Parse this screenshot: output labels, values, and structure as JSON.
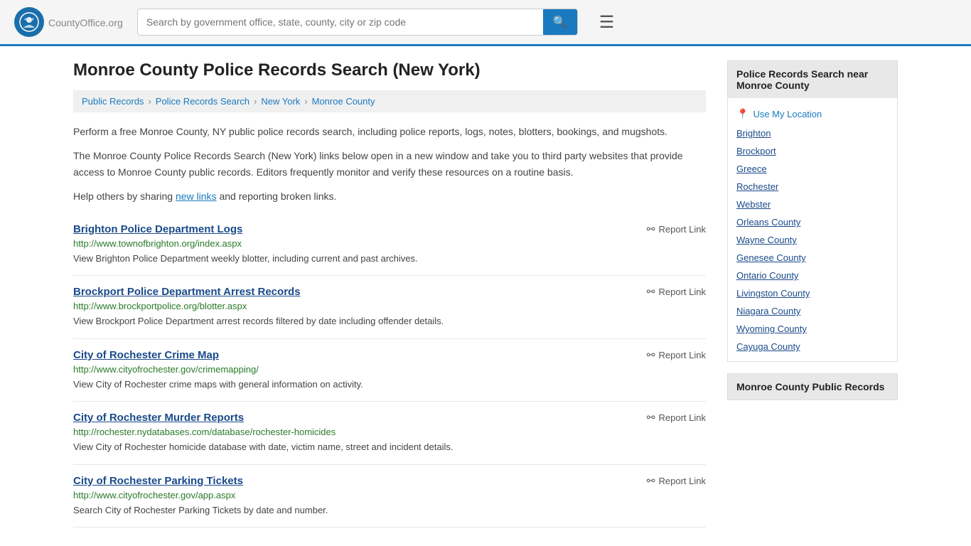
{
  "header": {
    "logo_text": "CountyOffice",
    "logo_suffix": ".org",
    "search_placeholder": "Search by government office, state, county, city or zip code"
  },
  "page": {
    "title": "Monroe County Police Records Search (New York)",
    "breadcrumb": [
      {
        "label": "Public Records",
        "href": "#"
      },
      {
        "label": "Police Records Search",
        "href": "#"
      },
      {
        "label": "New York",
        "href": "#"
      },
      {
        "label": "Monroe County",
        "href": "#"
      }
    ],
    "description1": "Perform a free Monroe County, NY public police records search, including police reports, logs, notes, blotters, bookings, and mugshots.",
    "description2": "The Monroe County Police Records Search (New York) links below open in a new window and take you to third party websites that provide access to Monroe County public records. Editors frequently monitor and verify these resources on a routine basis.",
    "description3_pre": "Help others by sharing ",
    "description3_link": "new links",
    "description3_post": " and reporting broken links."
  },
  "results": [
    {
      "title": "Brighton Police Department Logs",
      "url": "http://www.townofbrighton.org/index.aspx",
      "description": "View Brighton Police Department weekly blotter, including current and past archives.",
      "report_label": "Report Link"
    },
    {
      "title": "Brockport Police Department Arrest Records",
      "url": "http://www.brockportpolice.org/blotter.aspx",
      "description": "View Brockport Police Department arrest records filtered by date including offender details.",
      "report_label": "Report Link"
    },
    {
      "title": "City of Rochester Crime Map",
      "url": "http://www.cityofrochester.gov/crimemapping/",
      "description": "View City of Rochester crime maps with general information on activity.",
      "report_label": "Report Link"
    },
    {
      "title": "City of Rochester Murder Reports",
      "url": "http://rochester.nydatabases.com/database/rochester-homicides",
      "description": "View City of Rochester homicide database with date, victim name, street and incident details.",
      "report_label": "Report Link"
    },
    {
      "title": "City of Rochester Parking Tickets",
      "url": "http://www.cityofrochester.gov/app.aspx",
      "description": "Search City of Rochester Parking Tickets by date and number.",
      "report_label": "Report Link"
    }
  ],
  "sidebar": {
    "nearby_title": "Police Records Search near Monroe County",
    "use_my_location": "Use My Location",
    "nearby_links": [
      "Brighton",
      "Brockport",
      "Greece",
      "Rochester",
      "Webster",
      "Orleans County",
      "Wayne County",
      "Genesee County",
      "Ontario County",
      "Livingston County",
      "Niagara County",
      "Wyoming County",
      "Cayuga County"
    ],
    "public_records_title": "Monroe County Public Records"
  }
}
